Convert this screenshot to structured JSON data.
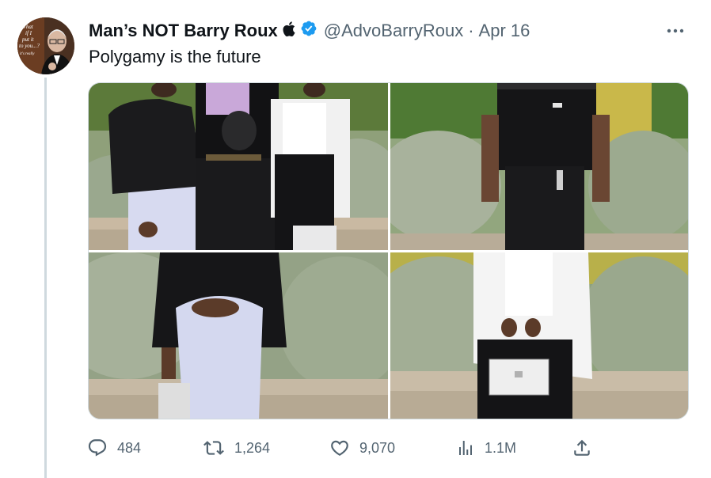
{
  "tweet": {
    "author_name": "Man’s NOT Barry Roux",
    "handle": "@AdvoBarryRoux",
    "separator": "·",
    "date": "Apr 16",
    "text": "Polygamy is the future",
    "avatar_lettering": "What if I put it to you...? it’s really"
  },
  "icons": {
    "apple": "apple-icon",
    "verified": "verified-badge-icon",
    "more": "more-options-icon",
    "reply": "reply-icon",
    "retweet": "retweet-icon",
    "like": "heart-icon",
    "views": "analytics-icon",
    "share": "share-icon"
  },
  "metrics": {
    "replies": "484",
    "retweets": "1,264",
    "likes": "9,070",
    "views": "1.1M"
  },
  "colors": {
    "verified": "#1d9bf0",
    "muted_text": "#536471",
    "thread_line": "#cfd9de"
  }
}
